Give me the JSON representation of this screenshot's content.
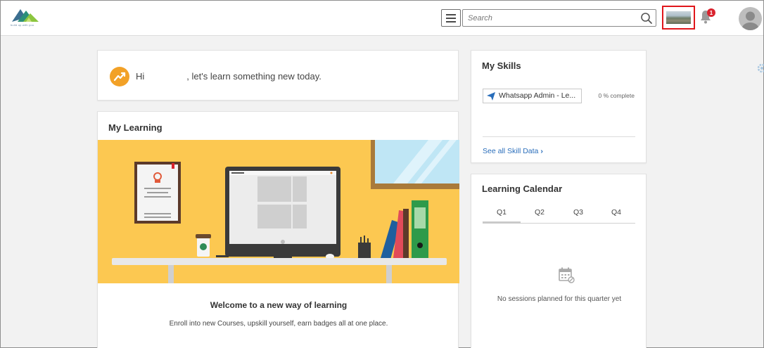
{
  "header": {
    "logo_text": "build up with you",
    "search_placeholder": "Search",
    "notification_count": "1"
  },
  "greeting": {
    "prefix": "Hi",
    "suffix": ", let's learn something new today."
  },
  "my_learning": {
    "title": "My Learning",
    "welcome_title": "Welcome to a new way of learning",
    "welcome_subtitle": "Enroll into new Courses, upskill yourself, earn badges all at one place."
  },
  "my_skills": {
    "title": "My Skills",
    "skill_name": "Whatsapp Admin - Le...",
    "skill_progress": "0 % complete",
    "see_all_label": "See all Skill Data"
  },
  "learning_calendar": {
    "title": "Learning Calendar",
    "tabs": [
      "Q1",
      "Q2",
      "Q3",
      "Q4"
    ],
    "active_tab": "Q1",
    "empty_message": "No sessions planned for this quarter yet"
  },
  "colors": {
    "accent_orange": "#f2a127",
    "link_blue": "#2a6ebb",
    "highlight_red": "#e0161b",
    "illustration_bg": "#fcc851"
  }
}
